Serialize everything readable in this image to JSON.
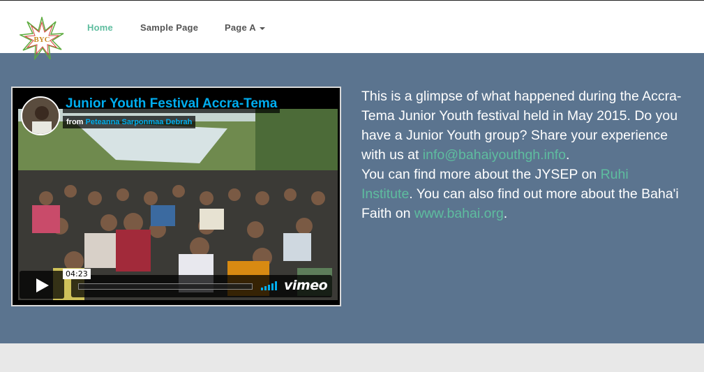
{
  "nav": {
    "logo_text": "BYC",
    "items": [
      {
        "label": "Home",
        "active": true
      },
      {
        "label": "Sample Page",
        "active": false
      },
      {
        "label": "Page A",
        "active": false,
        "has_dropdown": true
      }
    ]
  },
  "video": {
    "title": "Junior Youth Festival Accra-Tema",
    "byline_prefix": "from",
    "author": "Peteanna Sarponmaa Debrah",
    "duration": "04:23",
    "brand": "vimeo",
    "progress": 0
  },
  "content": {
    "para1": "This is a glimpse of what happened during the Accra-Tema Junior Youth festival held in May 2015. Do you have a Junior Youth group? Share your experience with us at",
    "email": "info@bahaiyouthgh.info",
    "para1_end": ".",
    "para2_start": "You can find more about the JYSEP on",
    "ruhi_link": "Ruhi Institute",
    "para2_mid": ". You can also find out more about the Baha'i Faith on",
    "bahai_link": "www.bahai.org",
    "para2_end": "."
  },
  "colors": {
    "accent": "#5ebd9f",
    "hero_bg": "#5b748f",
    "vimeo_blue": "#00adef",
    "footer_bg": "#e8e8e8"
  }
}
